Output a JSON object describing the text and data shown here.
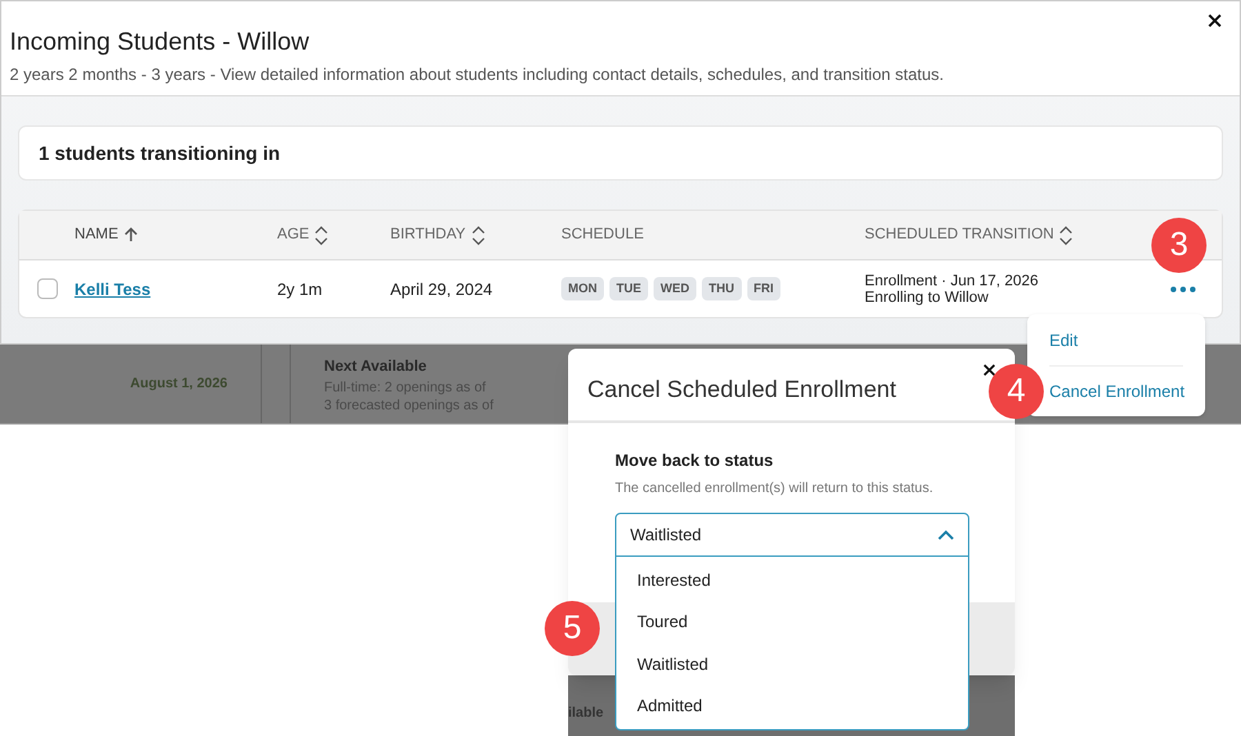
{
  "modal": {
    "title": "Incoming Students - Willow",
    "subtitle": "2 years 2 months - 3 years - View detailed information about students including contact details, schedules, and transition status.",
    "count_card": "1 students transitioning in",
    "table": {
      "columns": [
        {
          "label": "NAME",
          "sortable": true,
          "sorted": true
        },
        {
          "label": "AGE",
          "sortable": true,
          "sorted": false
        },
        {
          "label": "BIRTHDAY",
          "sortable": true,
          "sorted": false
        },
        {
          "label": "SCHEDULE",
          "sortable": false,
          "sorted": false
        },
        {
          "label": "SCHEDULED TRANSITION",
          "sortable": true,
          "sorted": false
        }
      ],
      "rows": [
        {
          "checked": false,
          "name": "Kelli Tess",
          "age": "2y 1m",
          "birthday": "April 29, 2024",
          "schedule": [
            "MON",
            "TUE",
            "WED",
            "THU",
            "FRI"
          ],
          "transition": [
            "Enrollment · Jun 17, 2026",
            "Enrolling to Willow"
          ]
        }
      ]
    }
  },
  "background_row": {
    "date": "August 1, 2026",
    "heading": "Next Available",
    "lines": [
      "Full-time: 2 openings as of",
      "3 forecasted openings as of"
    ],
    "fragment": "ilable"
  },
  "row_menu": {
    "items": [
      "Edit",
      "Cancel Enrollment"
    ]
  },
  "dialog": {
    "title": "Cancel Scheduled Enrollment",
    "field_label": "Move back to status",
    "field_help": "The cancelled enrollment(s) will return to this status.",
    "select": {
      "value": "Waitlisted",
      "expanded": true,
      "options": [
        "Interested",
        "Toured",
        "Waitlisted",
        "Admitted"
      ]
    }
  },
  "callouts": [
    "3",
    "4",
    "5"
  ]
}
